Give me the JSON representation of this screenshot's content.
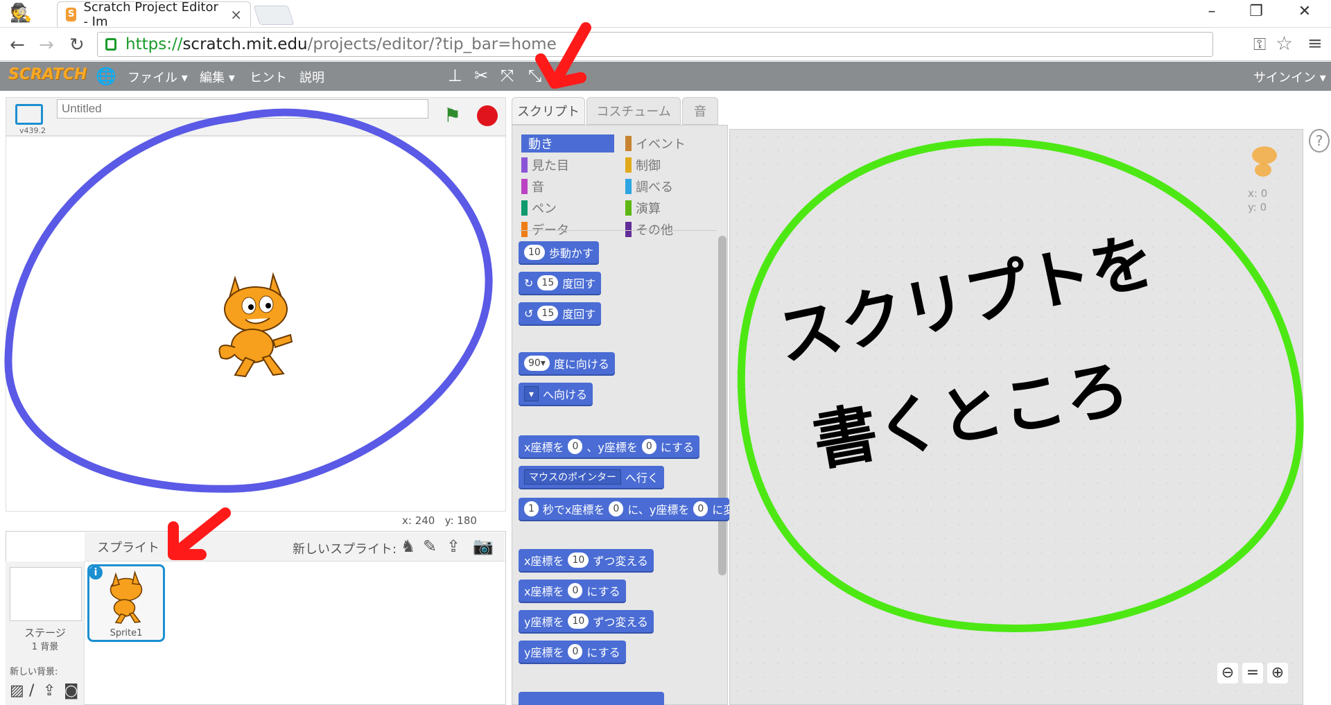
{
  "browser": {
    "tab_title": "Scratch Project Editor - Im",
    "tab_favicon": "S",
    "url_scheme": "https://",
    "url_host": "scratch.mit.edu",
    "url_path": "/projects/editor/?tip_bar=home"
  },
  "menu": {
    "logo": "SCRATCH",
    "items": [
      "ファイル ▾",
      "編集 ▾",
      "ヒント",
      "説明"
    ],
    "signin": "サインイン ▾"
  },
  "stage": {
    "title_placeholder": "Untitled",
    "version": "v439.2",
    "x_label": "x:",
    "x": "240",
    "y_label": "y:",
    "y": "180"
  },
  "sprites": {
    "header": "スプライト",
    "new_sprite": "新しいスプライト:",
    "stage_label": "ステージ",
    "backdrop_count": "1 背景",
    "new_backdrop": "新しい背景:",
    "sprite_name": "Sprite1"
  },
  "tabs": [
    "スクリプト",
    "コスチューム",
    "音"
  ],
  "categories_left": [
    {
      "label": "動き",
      "color": "#4a6cd4"
    },
    {
      "label": "見た目",
      "color": "#8a55d7"
    },
    {
      "label": "音",
      "color": "#bb42c3"
    },
    {
      "label": "ペン",
      "color": "#0e9a6c"
    },
    {
      "label": "データ",
      "color": "#ee7d16"
    }
  ],
  "categories_right": [
    {
      "label": "イベント",
      "color": "#c88330"
    },
    {
      "label": "制御",
      "color": "#e1a91a"
    },
    {
      "label": "調べる",
      "color": "#2ca5e2"
    },
    {
      "label": "演算",
      "color": "#5cb712"
    },
    {
      "label": "その他",
      "color": "#632d99"
    }
  ],
  "blocks": {
    "move": {
      "n": "10",
      "t": "歩動かす"
    },
    "turn_right": {
      "n": "15",
      "t": "度回す"
    },
    "turn_left": {
      "n": "15",
      "t": "度回す"
    },
    "point_dir": {
      "n": "90▾",
      "t": "度に向ける"
    },
    "point_towards": {
      "t": "へ向ける"
    },
    "goto_xy": {
      "a": "x座標を",
      "x": "0",
      "b": "、y座標を",
      "y": "0",
      "c": "にする"
    },
    "goto": {
      "d": "マウスのポインター",
      "t": "へ行く"
    },
    "glide": {
      "n": "1",
      "a": "秒でx座標を",
      "x": "0",
      "b": "に、y座標を",
      "y": "0",
      "c": "に変"
    },
    "change_x": {
      "a": "x座標を",
      "n": "10",
      "b": "ずつ変える"
    },
    "set_x": {
      "a": "x座標を",
      "n": "0",
      "b": "にする"
    },
    "change_y": {
      "a": "y座標を",
      "n": "10",
      "b": "ずつ変える"
    },
    "set_y": {
      "a": "y座標を",
      "n": "0",
      "b": "にする"
    }
  },
  "script_area": {
    "sprite_x": "x: 0",
    "sprite_y": "y: 0",
    "help": "?"
  },
  "annotation": {
    "handwriting_line1": "スクリプトを",
    "handwriting_line2": "書くところ"
  }
}
